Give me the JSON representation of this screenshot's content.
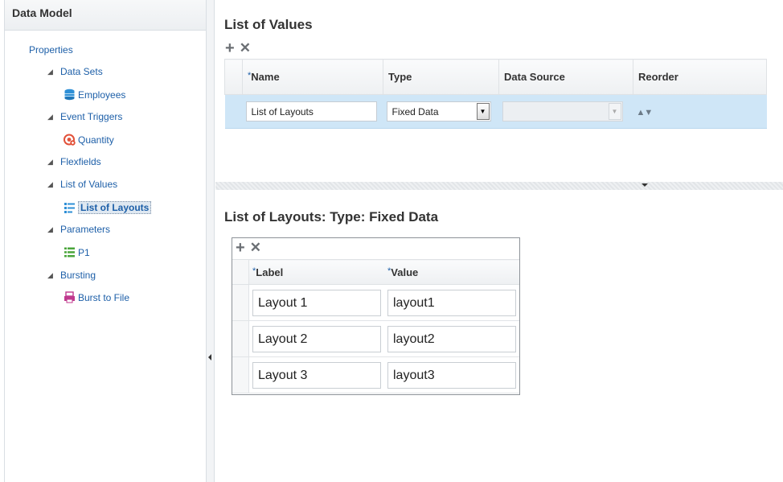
{
  "sidebar": {
    "title": "Data Model",
    "properties_label": "Properties",
    "data_sets_label": "Data Sets",
    "employees_label": "Employees",
    "event_triggers_label": "Event Triggers",
    "quantity_label": "Quantity",
    "flexfields_label": "Flexfields",
    "list_of_values_label": "List of Values",
    "list_of_layouts_label": "List of Layouts",
    "parameters_label": "Parameters",
    "p1_label": "P1",
    "bursting_label": "Bursting",
    "burst_to_file_label": "Burst to File",
    "expand_glyph": "◢"
  },
  "lov": {
    "title": "List of Values",
    "add_glyph": "+",
    "delete_glyph": "✕",
    "required_marker": "*",
    "columns": {
      "name": "Name",
      "type": "Type",
      "data_source": "Data Source",
      "reorder": "Reorder"
    },
    "row": {
      "name": "List of Layouts",
      "type": "Fixed Data",
      "data_source": "",
      "reorder_glyph": "▲▼"
    },
    "select_arrow": "▼"
  },
  "fixed_data": {
    "title": "List of Layouts: Type: Fixed Data",
    "add_glyph": "+",
    "delete_glyph": "✕",
    "required_marker": "*",
    "columns": {
      "label": "Label",
      "value": "Value"
    },
    "rows": [
      {
        "label": "Layout 1",
        "value": "layout1"
      },
      {
        "label": "Layout 2",
        "value": "layout2"
      },
      {
        "label": "Layout 3",
        "value": "layout3"
      }
    ]
  },
  "colors": {
    "link": "#1d5fa8",
    "selected_row": "#cfe6f7",
    "database_icon": "#2e8fd6",
    "trigger_icon": "#e2523a",
    "burst_icon": "#c0398e",
    "param_icon": "#4aa53b"
  }
}
